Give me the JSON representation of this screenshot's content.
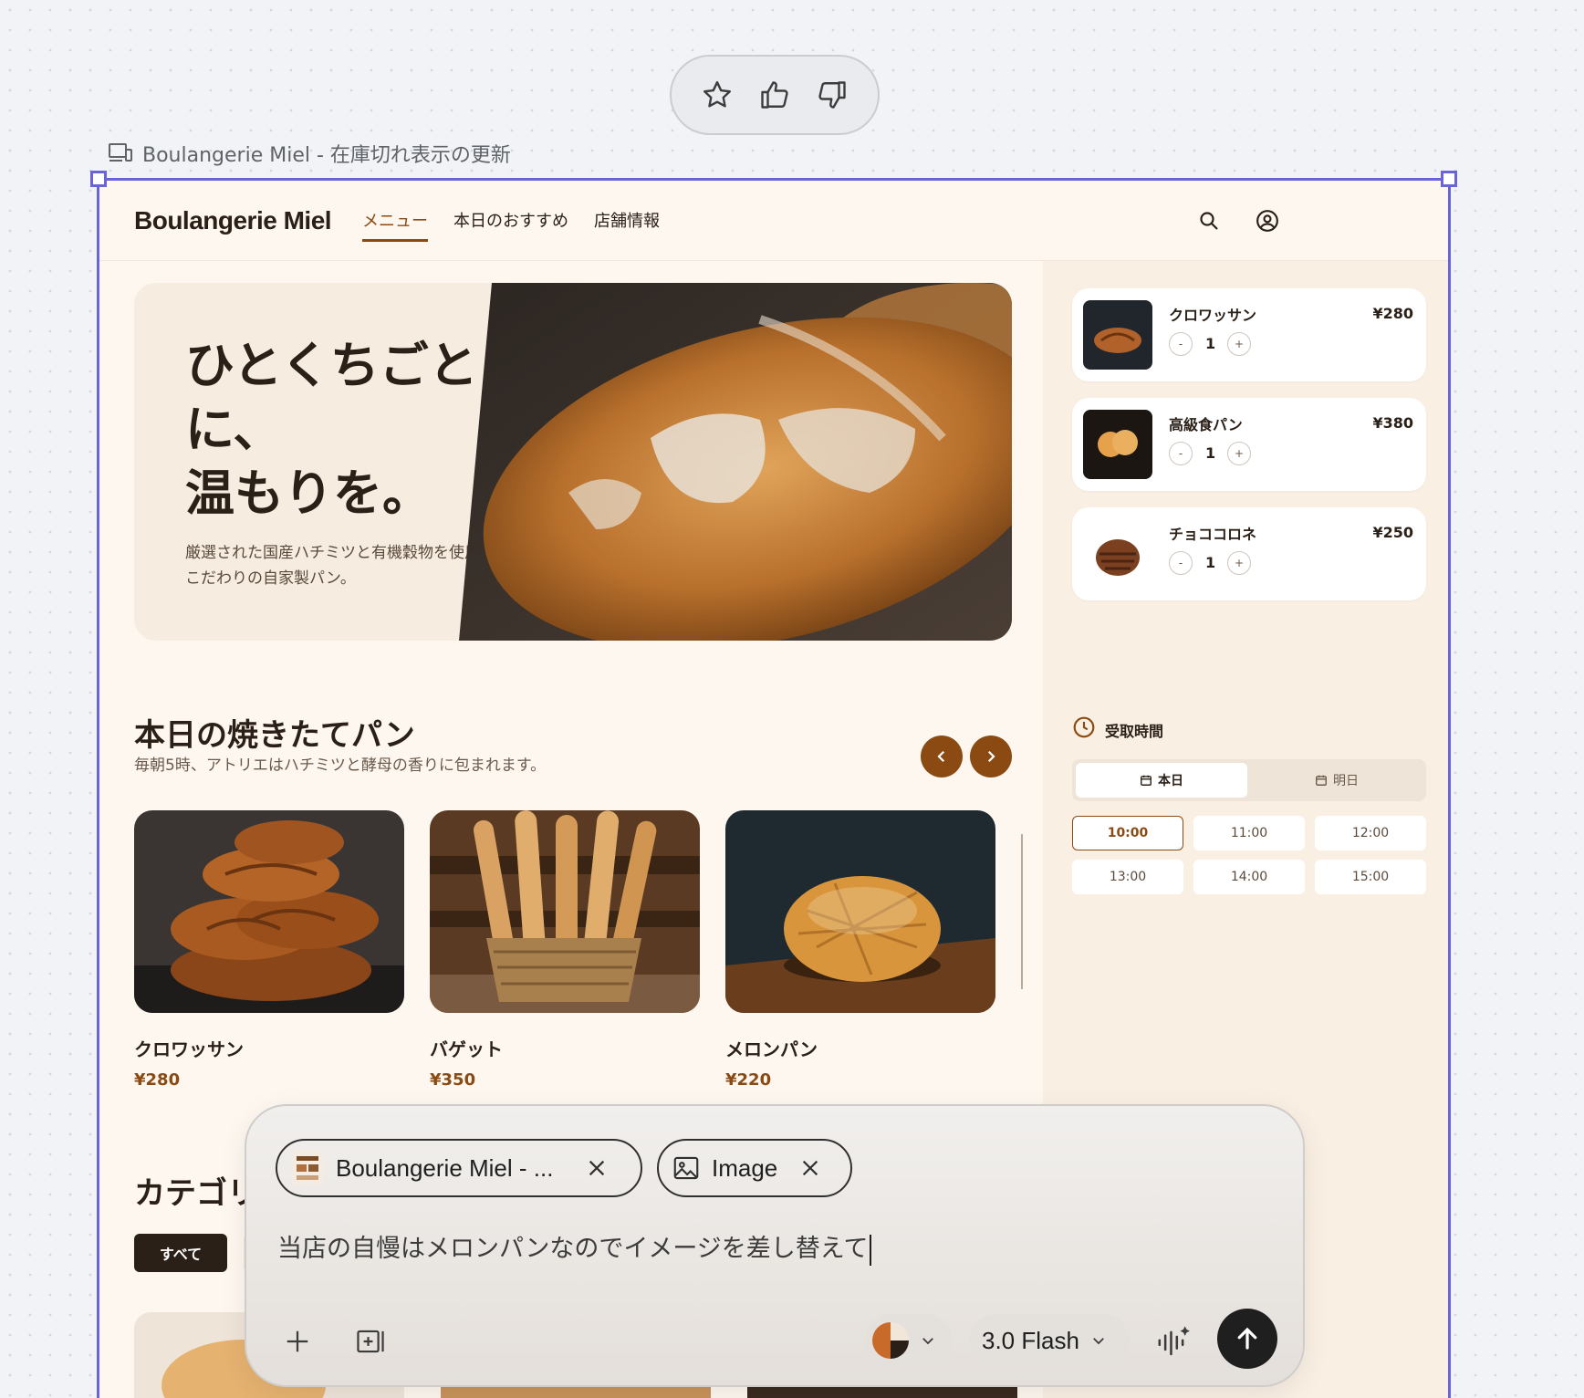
{
  "feedback": {
    "icons": [
      "star-icon",
      "thumbs-up-icon",
      "thumbs-down-icon"
    ]
  },
  "frame_label": "Boulangerie Miel - 在庫切れ表示の更新",
  "site": {
    "brand": "Boulangerie Miel",
    "nav": [
      "メニュー",
      "本日のおすすめ",
      "店舗情報"
    ],
    "hero": {
      "title_line1": "ひとくちごと",
      "title_line2": "に、",
      "title_line3": "温もりを。",
      "subtitle": "厳選された国産ハチミツと有機穀物を使用した、こだわりの自家製パン。"
    },
    "section": {
      "title": "本日の焼きたてパン",
      "subtitle": "毎朝5時、アトリエはハチミツと酵母の香りに包まれます。"
    },
    "products": [
      {
        "name": "クロワッサン",
        "price": "¥280"
      },
      {
        "name": "バゲット",
        "price": "¥350"
      },
      {
        "name": "メロンパン",
        "price": "¥220"
      }
    ],
    "categories": {
      "title": "カテゴリ",
      "chip_all": "すべて"
    },
    "cart": [
      {
        "name": "クロワッサン",
        "price": "¥280",
        "qty": "1"
      },
      {
        "name": "高級食パン",
        "price": "¥380",
        "qty": "1"
      },
      {
        "name": "チョココロネ",
        "price": "¥250",
        "qty": "1"
      }
    ],
    "qty_minus": "-",
    "qty_plus": "+",
    "pickup": {
      "label": "受取時間",
      "today": "本日",
      "tomorrow": "明日",
      "slots": [
        "10:00",
        "11:00",
        "12:00",
        "13:00",
        "14:00",
        "15:00"
      ],
      "selected": "10:00"
    }
  },
  "composer": {
    "chips": [
      {
        "label": "Boulangerie Miel - ...",
        "icon": "page-thumbnail-icon"
      },
      {
        "label": "Image",
        "icon": "image-icon"
      }
    ],
    "prompt": "当店の自慢はメロンパンなのでイメージを差し替えて",
    "model": "3.0 Flash"
  },
  "colors": {
    "accent": "#8a4a12",
    "frame": "#6b63d8",
    "background": "#fdf7f0"
  }
}
